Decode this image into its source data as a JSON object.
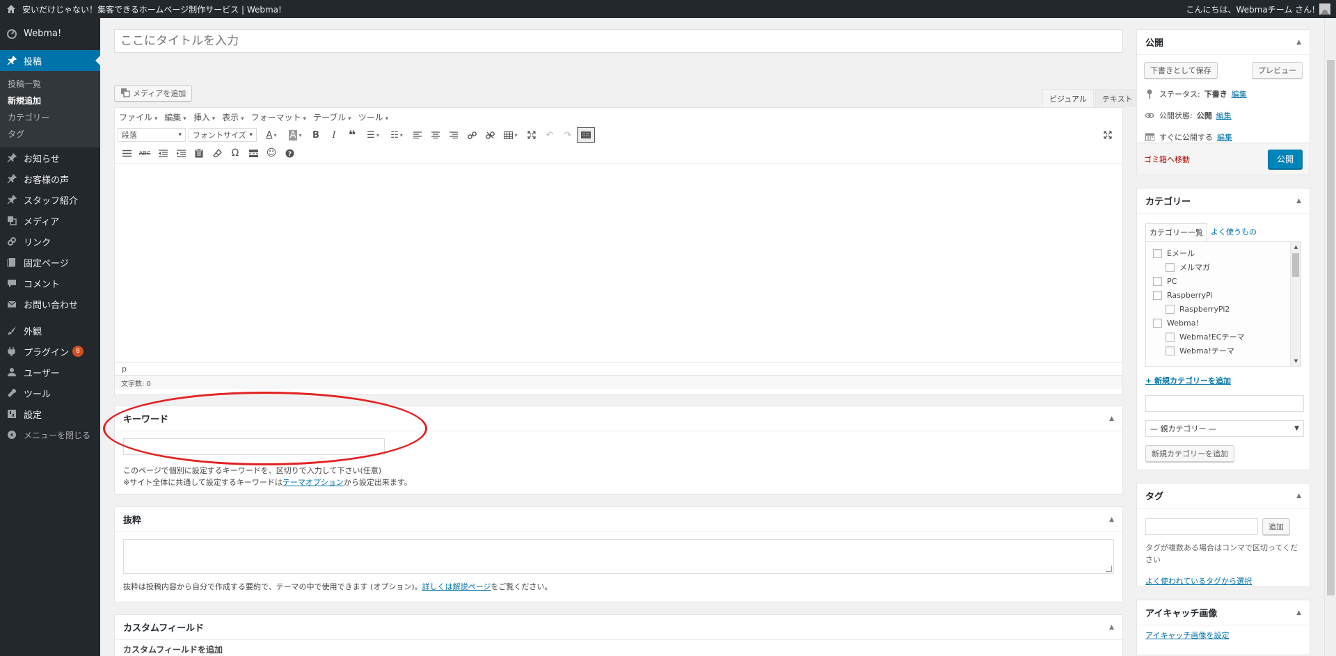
{
  "adminbar": {
    "site_title": "安いだけじゃない！集客できるホームページ制作サービス | Webma!",
    "greeting": "こんにちは、Webmaチーム さん!"
  },
  "sidebar": {
    "brand": "Webma!",
    "menu": [
      {
        "label": "投稿",
        "icon": "pin-icon",
        "current": true
      },
      {
        "label": "お知らせ",
        "icon": "pin-icon"
      },
      {
        "label": "お客様の声",
        "icon": "pin-icon"
      },
      {
        "label": "スタッフ紹介",
        "icon": "pin-icon"
      },
      {
        "label": "メディア",
        "icon": "media-icon"
      },
      {
        "label": "リンク",
        "icon": "link-icon"
      },
      {
        "label": "固定ページ",
        "icon": "page-icon"
      },
      {
        "label": "コメント",
        "icon": "comment-icon"
      },
      {
        "label": "お問い合わせ",
        "icon": "mail-icon"
      },
      {
        "label": "外観",
        "icon": "brush-icon"
      },
      {
        "label": "プラグイン",
        "icon": "plugin-icon",
        "badge": "8"
      },
      {
        "label": "ユーザー",
        "icon": "user-icon"
      },
      {
        "label": "ツール",
        "icon": "wrench-icon"
      },
      {
        "label": "設定",
        "icon": "settings-icon"
      }
    ],
    "submenu": [
      "投稿一覧",
      "新規追加",
      "カテゴリー",
      "タグ"
    ],
    "collapse_label": "メニューを閉じる"
  },
  "editor": {
    "title_placeholder": "ここにタイトルを入力",
    "media_button": "メディアを追加",
    "tab_visual": "ビジュアル",
    "tab_text": "テキスト",
    "menubar": [
      "ファイル",
      "編集",
      "挿入",
      "表示",
      "フォーマット",
      "テーブル",
      "ツール"
    ],
    "format_select": "段落",
    "fontsize_select": "フォントサイズ",
    "path": "p",
    "wordcount": "文字数: 0"
  },
  "keyword_box": {
    "title": "キーワード",
    "help1": "このページで個別に設定するキーワードを、区切りで入力して下さい(任意)",
    "help2_pre": "※サイト全体に共通して設定するキーワードは",
    "help2_link": "テーマオプション",
    "help2_post": "から設定出来ます。"
  },
  "excerpt_box": {
    "title": "抜粋",
    "help_pre": "抜粋は投稿内容から自分で作成する要約で、テーマの中で使用できます (オプション)。",
    "help_link": "詳しくは解説ページ",
    "help_post": "をご覧ください。"
  },
  "custom_box": {
    "title": "カスタムフィールド",
    "sub": "カスタムフィールドを追加"
  },
  "publish_box": {
    "title": "公開",
    "save_draft": "下書きとして保存",
    "preview": "プレビュー",
    "status_label": "ステータス:",
    "status_value": "下書き",
    "visibility_label": "公開状態:",
    "visibility_value": "公開",
    "schedule_label": "すぐに公開する",
    "edit": "編集",
    "trash": "ゴミ箱へ移動",
    "publish": "公開"
  },
  "category_box": {
    "title": "カテゴリー",
    "tab_all": "カテゴリー一覧",
    "tab_popular": "よく使うもの",
    "items": [
      {
        "label": "Eメール",
        "child": false
      },
      {
        "label": "メルマガ",
        "child": true
      },
      {
        "label": "PC",
        "child": false
      },
      {
        "label": "RaspberryPi",
        "child": false
      },
      {
        "label": "RaspberryPi2",
        "child": true
      },
      {
        "label": "Webma!",
        "child": false
      },
      {
        "label": "Webma!ECテーマ",
        "child": true
      },
      {
        "label": "Webma!テーマ",
        "child": true
      }
    ],
    "add_link": "+ 新規カテゴリーを追加",
    "parent_select": "— 親カテゴリー —",
    "add_button": "新規カテゴリーを追加"
  },
  "tag_box": {
    "title": "タグ",
    "add_button": "追加",
    "help": "タグが複数ある場合はコンマで区切ってください",
    "popular_link": "よく使われているタグから選択"
  },
  "eyecatch_box": {
    "title": "アイキャッチ画像",
    "link": "アイキャッチ画像を設定"
  }
}
